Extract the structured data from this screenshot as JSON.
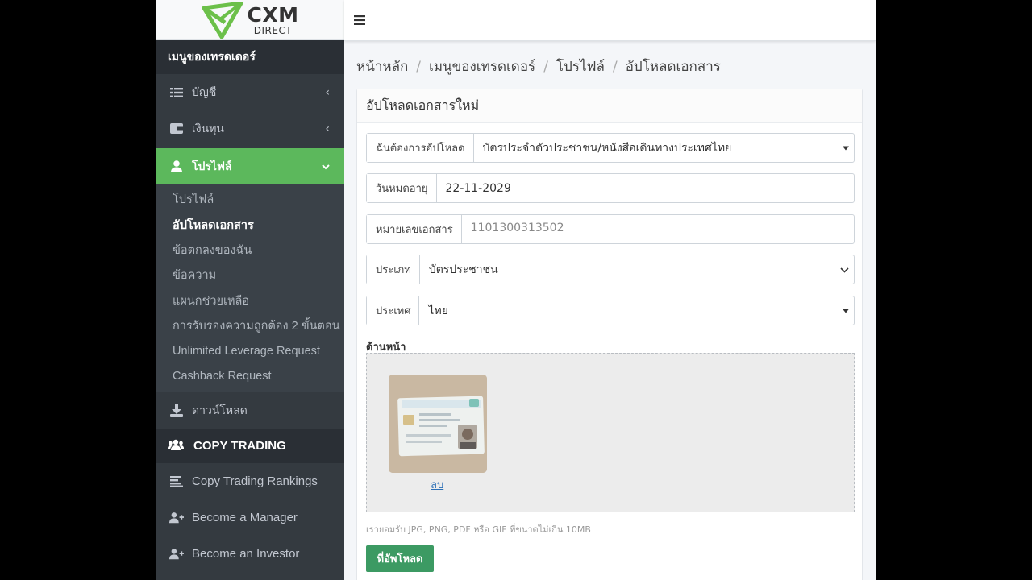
{
  "brand": {
    "name": "CXM",
    "sub": "DIRECT"
  },
  "sidebar": {
    "section_title": "เมนูของเทรดเดอร์",
    "items": [
      {
        "label": "บัญชี",
        "icon": "list-icon"
      },
      {
        "label": "เงินทุน",
        "icon": "wallet-icon"
      },
      {
        "label": "โปรไฟล์",
        "icon": "user-icon",
        "active": true
      }
    ],
    "profile_sub": [
      {
        "label": "โปรไฟล์"
      },
      {
        "label": "อัปโหลดเอกสาร",
        "active": true
      },
      {
        "label": "ข้อตกลงของฉัน"
      },
      {
        "label": "ข้อความ"
      },
      {
        "label": "แผนกช่วยเหลือ"
      },
      {
        "label": "การรับรองความถูกต้อง 2 ขั้นตอน"
      },
      {
        "label": "Unlimited Leverage Request"
      },
      {
        "label": "Cashback Request"
      }
    ],
    "download": {
      "label": "ดาวน์โหลด"
    },
    "copy_trading": {
      "title": "COPY TRADING",
      "items": [
        {
          "label": "Copy Trading Rankings"
        },
        {
          "label": "Become a Manager"
        },
        {
          "label": "Become an Investor"
        }
      ]
    }
  },
  "breadcrumb": [
    "หน้าหลัก",
    "เมนูของเทรดเดอร์",
    "โปรไฟล์",
    "อัปโหลดเอกสาร"
  ],
  "form": {
    "title": "อัปโหลดเอกสารใหม่",
    "upload_type": {
      "label": "ฉันต้องการอัปโหลด",
      "value": "บัตรประจำตัวประชาชน/หนังสือเดินทางประเทศไทย"
    },
    "expiry": {
      "label": "วันหมดอายุ",
      "value": "22-11-2029"
    },
    "doc_number": {
      "label": "หมายเลขเอกสาร",
      "value": "1101300313502"
    },
    "doc_type": {
      "label": "ประเภท",
      "value": "บัตรประชาชน"
    },
    "country": {
      "label": "ประเทศ",
      "value": "ไทย"
    },
    "front_label": "ด้านหน้า",
    "delete_label": "ลบ",
    "hint": "เรายอมรับ JPG, PNG, PDF หรือ GIF ที่ขนาดไม่เกิน 10MB",
    "submit_label": "ที่อัพโหลด"
  },
  "colors": {
    "sidebar_bg": "#343a40",
    "active_green": "#5cb85c",
    "button_green": "#3c9a63",
    "logo_green": "#6cc04a"
  }
}
